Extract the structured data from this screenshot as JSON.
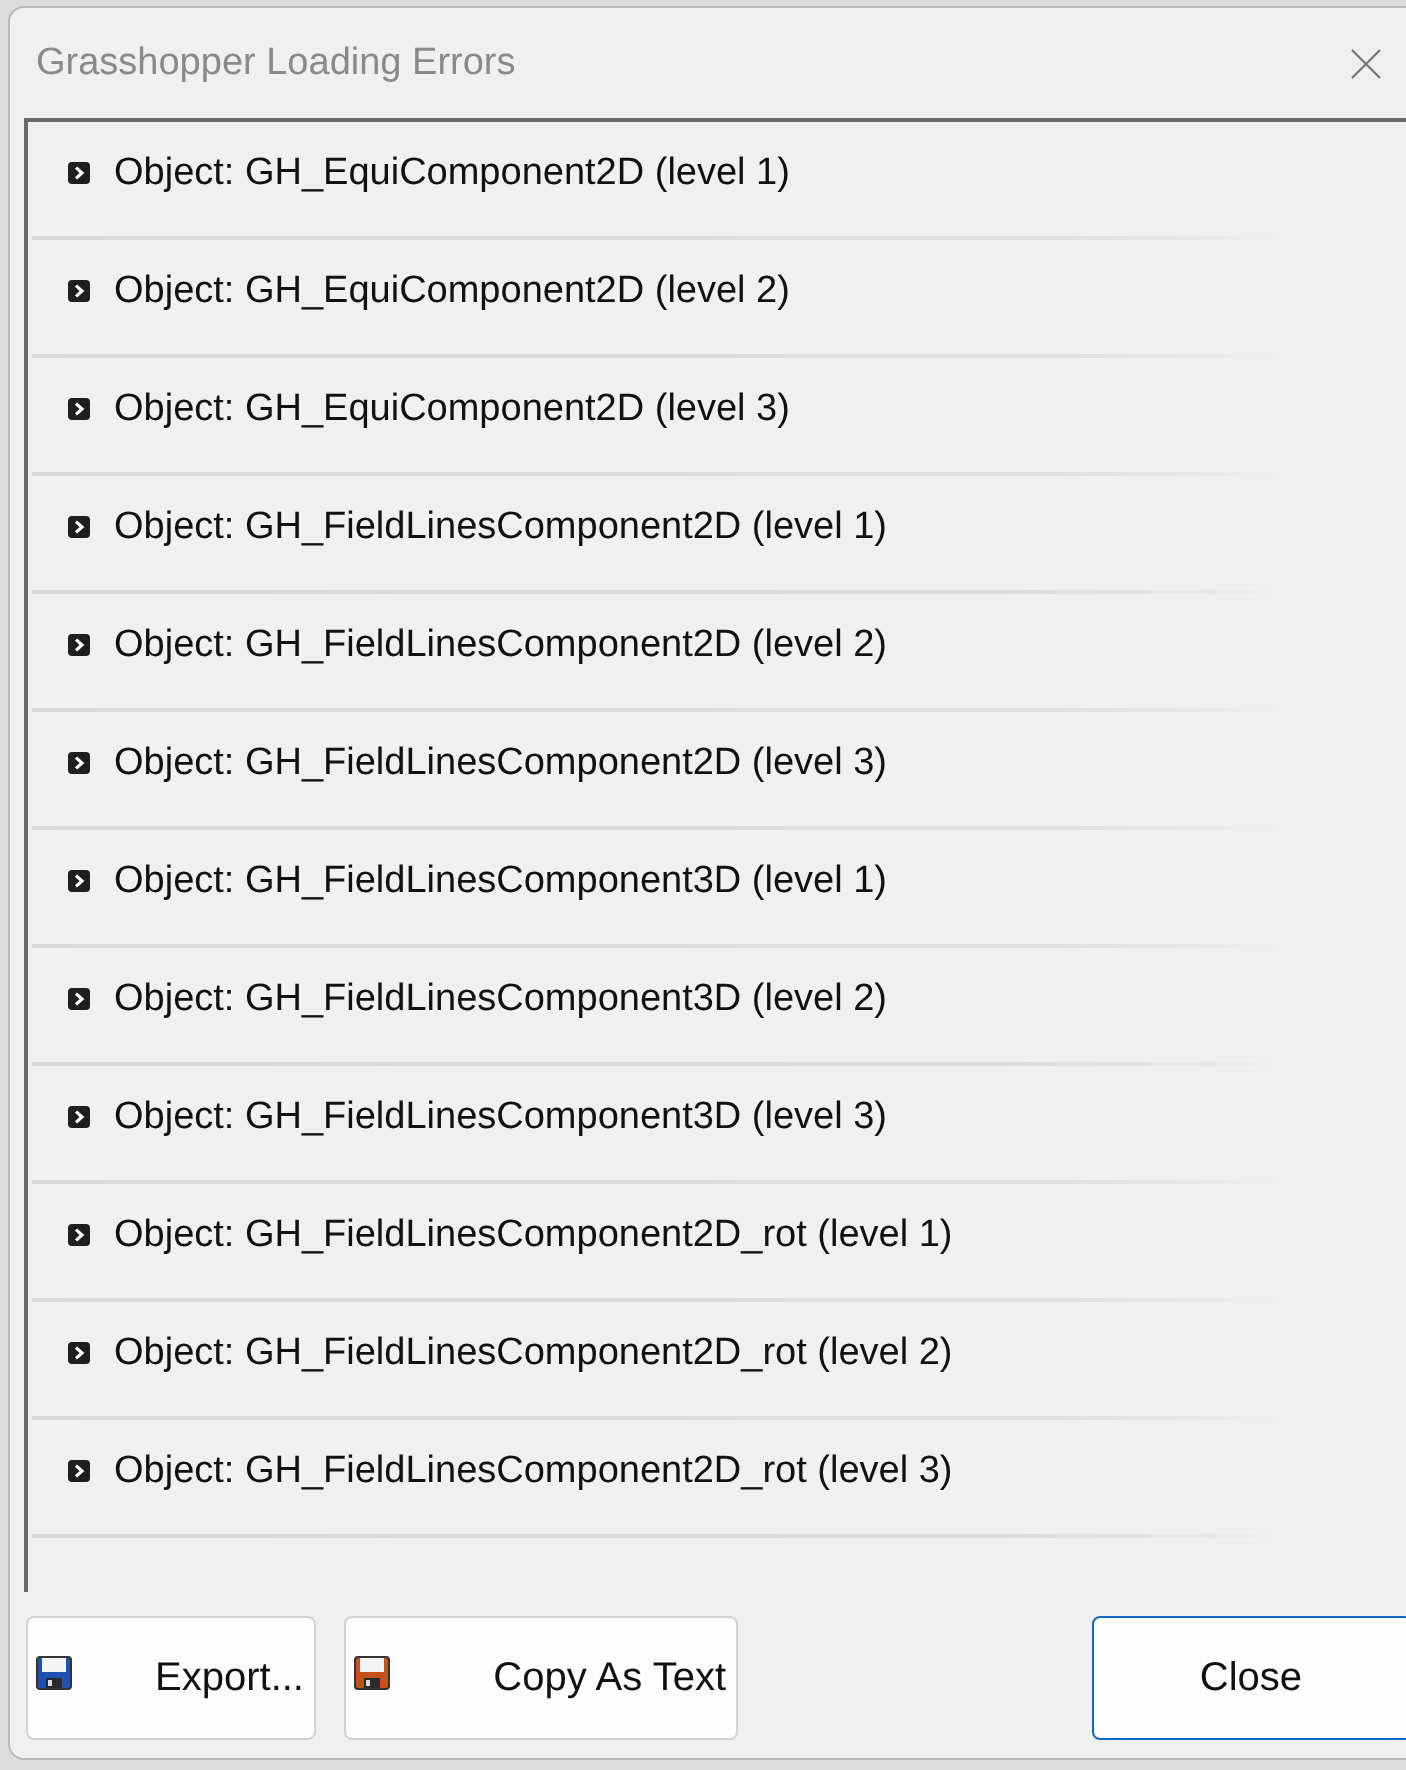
{
  "window": {
    "title": "Grasshopper Loading Errors"
  },
  "errors": [
    {
      "text": "Object: GH_EquiComponent2D (level 1)",
      "expanded": false
    },
    {
      "text": "Object: GH_EquiComponent2D (level 2)",
      "expanded": false
    },
    {
      "text": "Object: GH_EquiComponent2D (level 3)",
      "expanded": false
    },
    {
      "text": "Object: GH_FieldLinesComponent2D (level 1)",
      "expanded": false
    },
    {
      "text": "Object: GH_FieldLinesComponent2D (level 2)",
      "expanded": false
    },
    {
      "text": "Object: GH_FieldLinesComponent2D (level 3)",
      "expanded": false
    },
    {
      "text": "Object: GH_FieldLinesComponent3D (level 1)",
      "expanded": false
    },
    {
      "text": "Object: GH_FieldLinesComponent3D (level 2)",
      "expanded": false
    },
    {
      "text": "Object: GH_FieldLinesComponent3D (level 3)",
      "expanded": false
    },
    {
      "text": "Object: GH_FieldLinesComponent2D_rot (level 1)",
      "expanded": false
    },
    {
      "text": "Object: GH_FieldLinesComponent2D_rot (level 2)",
      "expanded": false
    },
    {
      "text": "Object: GH_FieldLinesComponent2D_rot (level 3)",
      "expanded": false
    }
  ],
  "buttons": [
    {
      "kind": "icon",
      "label": "Export...",
      "color": "#1f4fb0",
      "default": false
    },
    {
      "kind": "icon",
      "label": "Copy As Text",
      "color": "#c4521a",
      "default": false
    },
    {
      "kind": "plain",
      "label": "Close",
      "default": true
    }
  ]
}
